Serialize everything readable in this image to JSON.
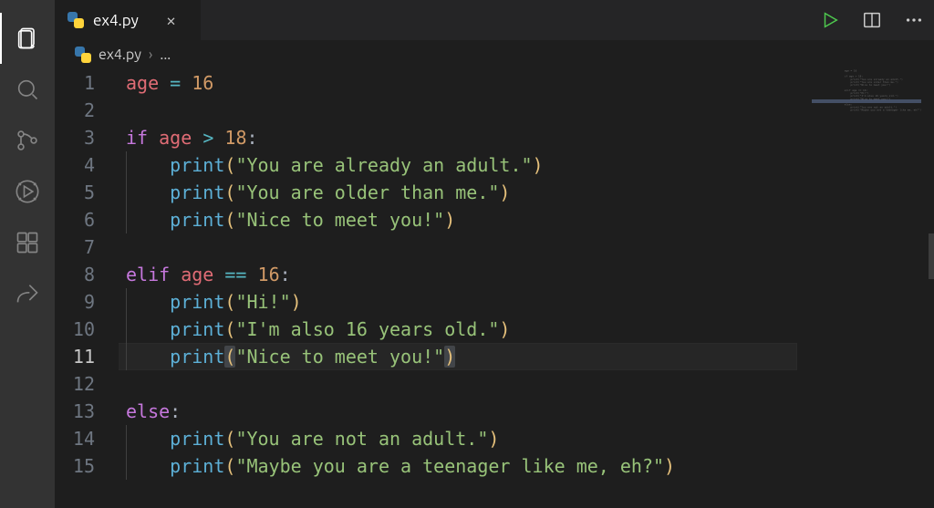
{
  "tab": {
    "filename": "ex4.py",
    "close_glyph": "×"
  },
  "breadcrumb": {
    "filename": "ex4.py",
    "sep": "›",
    "rest": "..."
  },
  "toolbar": {
    "run": "Run",
    "split": "Split Editor",
    "more": "More Actions"
  },
  "activity": [
    "explorer",
    "search",
    "source-control",
    "run-debug",
    "extensions",
    "live-share"
  ],
  "code": {
    "lines": [
      {
        "n": 1,
        "tokens": [
          [
            "id",
            "age"
          ],
          [
            "lp",
            " "
          ],
          [
            "op",
            "="
          ],
          [
            "lp",
            " "
          ],
          [
            "num",
            "16"
          ]
        ]
      },
      {
        "n": 2,
        "tokens": []
      },
      {
        "n": 3,
        "tokens": [
          [
            "kw",
            "if"
          ],
          [
            "lp",
            " "
          ],
          [
            "id",
            "age"
          ],
          [
            "lp",
            " "
          ],
          [
            "op",
            ">"
          ],
          [
            "lp",
            " "
          ],
          [
            "num",
            "18"
          ],
          [
            "lp",
            ":"
          ]
        ]
      },
      {
        "n": 4,
        "indent": 1,
        "tokens": [
          [
            "fn",
            "print"
          ],
          [
            "pn",
            "("
          ],
          [
            "str",
            "\"You are already an adult.\""
          ],
          [
            "pn",
            ")"
          ]
        ]
      },
      {
        "n": 5,
        "indent": 1,
        "tokens": [
          [
            "fn",
            "print"
          ],
          [
            "pn",
            "("
          ],
          [
            "str",
            "\"You are older than me.\""
          ],
          [
            "pn",
            ")"
          ]
        ]
      },
      {
        "n": 6,
        "indent": 1,
        "tokens": [
          [
            "fn",
            "print"
          ],
          [
            "pn",
            "("
          ],
          [
            "str",
            "\"Nice to meet you!\""
          ],
          [
            "pn",
            ")"
          ]
        ]
      },
      {
        "n": 7,
        "tokens": []
      },
      {
        "n": 8,
        "tokens": [
          [
            "kw",
            "elif"
          ],
          [
            "lp",
            " "
          ],
          [
            "id",
            "age"
          ],
          [
            "lp",
            " "
          ],
          [
            "op",
            "=="
          ],
          [
            "lp",
            " "
          ],
          [
            "num",
            "16"
          ],
          [
            "lp",
            ":"
          ]
        ]
      },
      {
        "n": 9,
        "indent": 1,
        "tokens": [
          [
            "fn",
            "print"
          ],
          [
            "pn",
            "("
          ],
          [
            "str",
            "\"Hi!\""
          ],
          [
            "pn",
            ")"
          ]
        ]
      },
      {
        "n": 10,
        "indent": 1,
        "tokens": [
          [
            "fn",
            "print"
          ],
          [
            "pn",
            "("
          ],
          [
            "str",
            "\"I'm also 16 years old.\""
          ],
          [
            "pn",
            ")"
          ]
        ]
      },
      {
        "n": 11,
        "indent": 1,
        "current": true,
        "hl": true,
        "tokens": [
          [
            "fn",
            "print"
          ],
          [
            "pn",
            "("
          ],
          [
            "str",
            "\"Nice to meet you!\""
          ],
          [
            "pn",
            ")"
          ]
        ]
      },
      {
        "n": 12,
        "tokens": []
      },
      {
        "n": 13,
        "tokens": [
          [
            "kw",
            "else"
          ],
          [
            "lp",
            ":"
          ]
        ]
      },
      {
        "n": 14,
        "indent": 1,
        "tokens": [
          [
            "fn",
            "print"
          ],
          [
            "pn",
            "("
          ],
          [
            "str",
            "\"You are not an adult.\""
          ],
          [
            "pn",
            ")"
          ]
        ]
      },
      {
        "n": 15,
        "indent": 1,
        "tokens": [
          [
            "fn",
            "print"
          ],
          [
            "pn",
            "("
          ],
          [
            "str",
            "\"Maybe you are a teenager like me, eh?\""
          ],
          [
            "pn",
            ")"
          ]
        ]
      }
    ]
  }
}
